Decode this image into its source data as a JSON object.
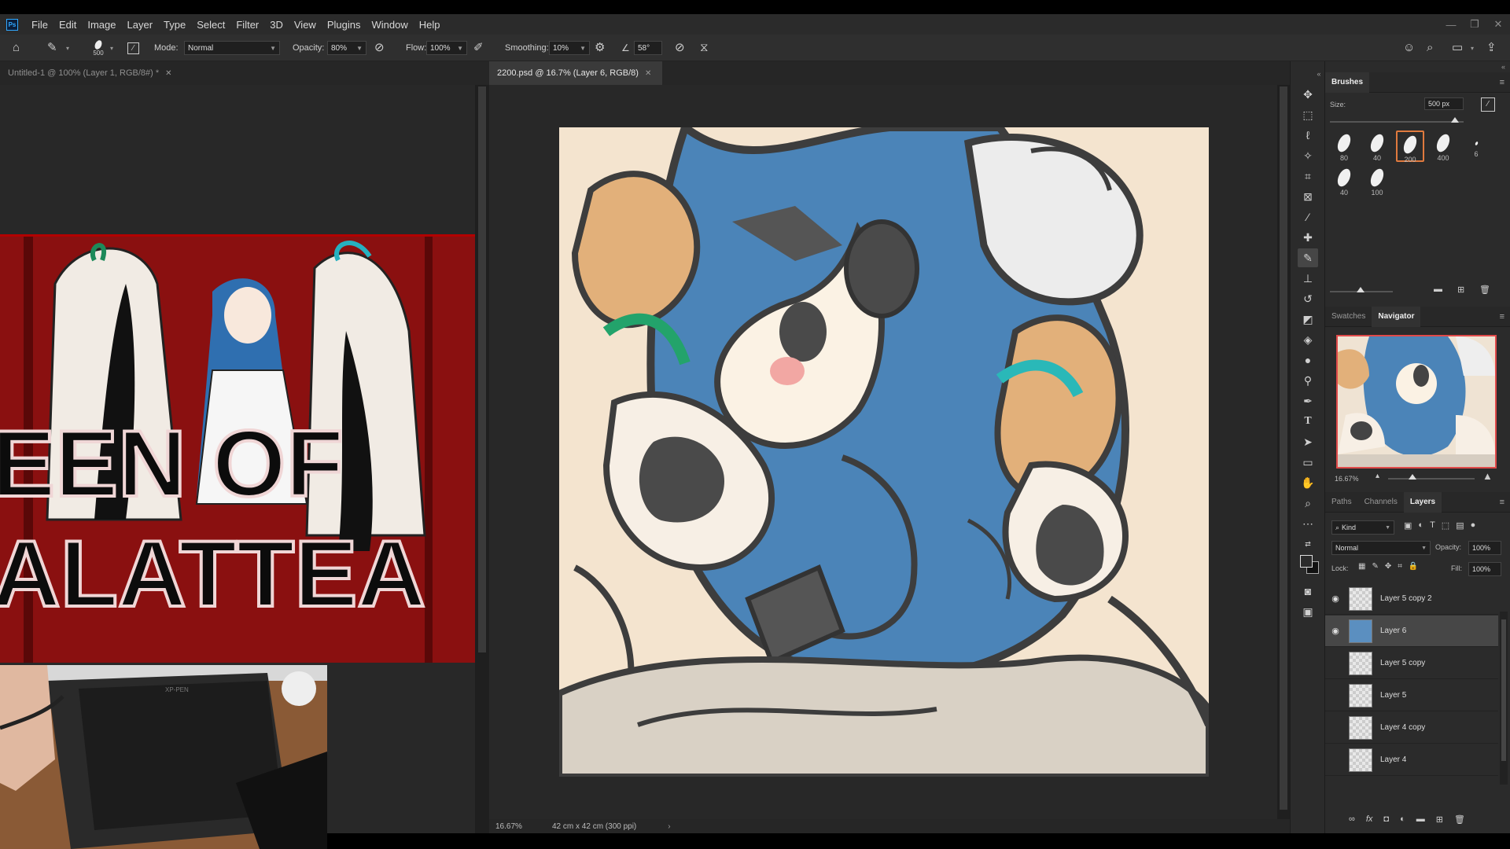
{
  "app": {
    "logo": "Ps"
  },
  "menu": [
    "File",
    "Edit",
    "Image",
    "Layer",
    "Type",
    "Select",
    "Filter",
    "3D",
    "View",
    "Plugins",
    "Window",
    "Help"
  ],
  "options": {
    "brush_size": "500",
    "mode_label": "Mode:",
    "mode_value": "Normal",
    "opacity_label": "Opacity:",
    "opacity_value": "80%",
    "flow_label": "Flow:",
    "flow_value": "100%",
    "smoothing_label": "Smoothing:",
    "smoothing_value": "10%",
    "angle_value": "58°"
  },
  "tabs": [
    {
      "label": "Untitled-1 @ 100% (Layer 1, RGB/8#) *",
      "active": false
    },
    {
      "label": "2200.psd @ 16.7% (Layer 6, RGB/8)",
      "active": true
    }
  ],
  "status": {
    "zoom": "16.67%",
    "doc_info": "42 cm x 42 cm (300 ppi)"
  },
  "thumbnail": {
    "text_line1": "EEN OF",
    "text_line2": "ALATTEA"
  },
  "webcam": {
    "tablet_brand": "XP-PEN"
  },
  "brushes": {
    "title": "Brushes",
    "size_label": "Size:",
    "size_value": "500 px",
    "presets": [
      "80",
      "40",
      "200",
      "400",
      "6",
      "40",
      "100"
    ],
    "selected_index": 2
  },
  "navigator": {
    "tabs": [
      "Swatches",
      "Navigator"
    ],
    "active": "Navigator",
    "zoom": "16.67%"
  },
  "layers_panel": {
    "tabs": [
      "Paths",
      "Channels",
      "Layers"
    ],
    "active": "Layers",
    "filter": "Kind",
    "blend": "Normal",
    "opacity_label": "Opacity:",
    "opacity": "100%",
    "lock_label": "Lock:",
    "fill_label": "Fill:",
    "fill": "100%",
    "layers": [
      {
        "name": "Layer 5 copy 2",
        "visible": true,
        "selected": false
      },
      {
        "name": "Layer 6",
        "visible": true,
        "selected": true
      },
      {
        "name": "Layer 5 copy",
        "visible": false,
        "selected": false
      },
      {
        "name": "Layer 5",
        "visible": false,
        "selected": false
      },
      {
        "name": "Layer 4 copy",
        "visible": false,
        "selected": false
      },
      {
        "name": "Layer 4",
        "visible": false,
        "selected": false
      }
    ]
  }
}
